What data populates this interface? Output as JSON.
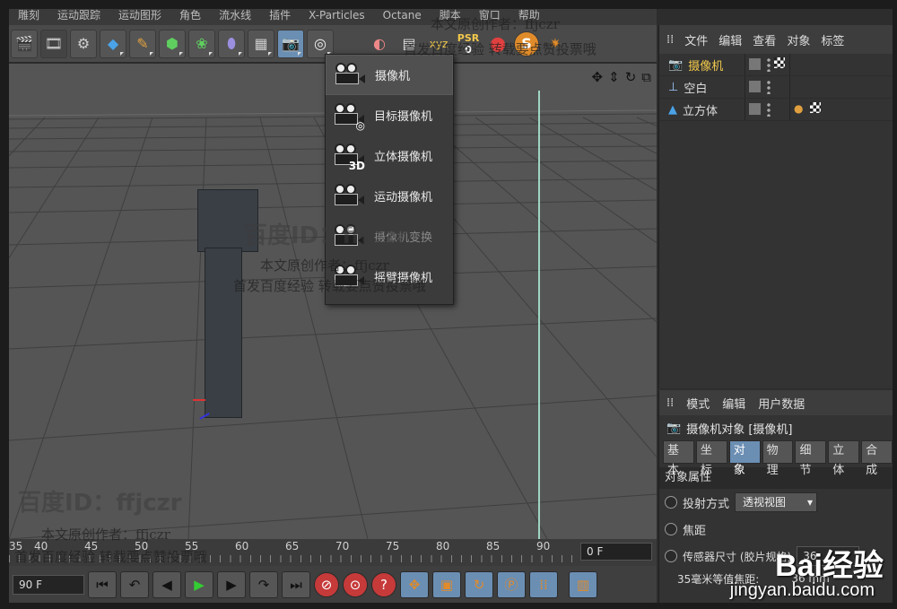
{
  "menubar": [
    "雕刻",
    "运动跟踪",
    "运动图形",
    "角色",
    "流水线",
    "插件",
    "X-Particles",
    "Octane",
    "脚本",
    "窗口",
    "帮助"
  ],
  "toolbar": {
    "icons": [
      "film-icon",
      "render-view-icon",
      "render-settings-icon",
      "cube-icon",
      "pen-icon",
      "subdivision-icon",
      "array-icon",
      "deformer-icon",
      "floor-icon",
      "camera-icon",
      "light-icon"
    ],
    "psr_label": "PSR",
    "psr_value": "0"
  },
  "viewport": {
    "hud_icons": [
      "move-view-icon",
      "zoom-view-icon",
      "rotate-view-icon",
      "maximize-view-icon"
    ]
  },
  "dropdown": {
    "items": [
      {
        "label": "摄像机",
        "sub": ""
      },
      {
        "label": "目标摄像机",
        "sub": ""
      },
      {
        "label": "立体摄像机",
        "sub": "3D"
      },
      {
        "label": "运动摄像机",
        "sub": ""
      },
      {
        "label": "摄像机变换",
        "sub": ""
      },
      {
        "label": "摇臂摄像机",
        "sub": ""
      }
    ]
  },
  "timeline": {
    "ticks": [
      "35",
      "40",
      "45",
      "50",
      "55",
      "60",
      "65",
      "70",
      "75",
      "80",
      "85",
      "90"
    ],
    "current_frame": "0 F"
  },
  "transport": {
    "end_frame": "90 F"
  },
  "object_manager": {
    "menu": [
      "文件",
      "编辑",
      "查看",
      "对象",
      "标签"
    ],
    "objects": [
      {
        "name": "摄像机",
        "selected": true
      },
      {
        "name": "空白",
        "selected": false
      },
      {
        "name": "立方体",
        "selected": false
      }
    ]
  },
  "attribute_manager": {
    "menu": [
      "模式",
      "编辑",
      "用户数据"
    ],
    "title": "摄像机对象 [摄像机]",
    "tabs": [
      "基本",
      "坐标",
      "对象",
      "物理",
      "细节",
      "立体",
      "合成"
    ],
    "active_tab": "对象",
    "section": "对象属性",
    "props": [
      {
        "label": "投射方式",
        "value": "透视视图"
      },
      {
        "label": "焦距",
        "value": ""
      },
      {
        "label": "传感器尺寸 (胶片规格)",
        "value": "36"
      },
      {
        "label": "35毫米等值焦距:",
        "value": "36 mm"
      }
    ]
  },
  "watermarks": {
    "id_text": "百度ID：ffjczr",
    "line1": "本文原创作者：ffjczr",
    "line2": "首发百度经验 转载要点赞投票哦",
    "logo": "Bai经验",
    "url": "jingyan.baidu.com"
  },
  "colors": {
    "selection": "#f2c94c",
    "accent_blue": "#6b8eb3",
    "viewport_bg": "#555555"
  }
}
